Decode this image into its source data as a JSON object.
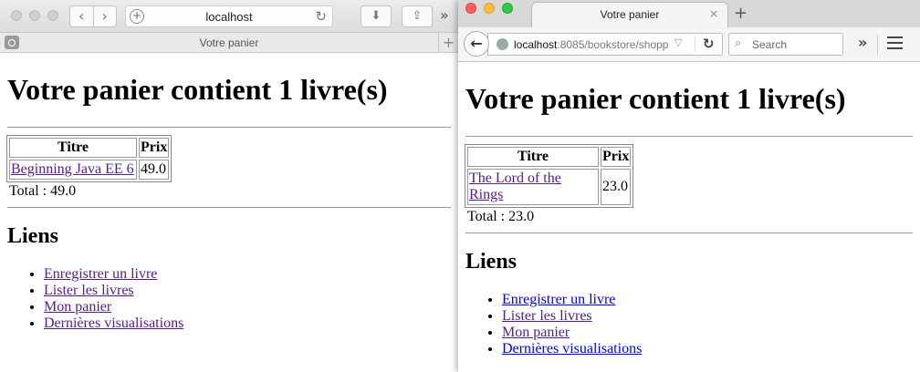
{
  "left": {
    "address": "localhost",
    "tab_title": "Votre panier",
    "page": {
      "heading": "Votre panier contient 1 livre(s)",
      "table": {
        "headers": [
          "Titre",
          "Prix"
        ],
        "rows": [
          {
            "title": "Beginning Java EE 6",
            "price": "49.0"
          }
        ]
      },
      "total": "Total : 49.0",
      "links_heading": "Liens",
      "links": [
        "Enregistrer un livre",
        "Lister les livres",
        "Mon panier",
        "Dernières visualisations"
      ]
    }
  },
  "right": {
    "tab_title": "Votre panier",
    "url_host": "localhost",
    "url_rest": ":8085/bookstore/shopp",
    "search_placeholder": "Search",
    "page": {
      "heading": "Votre panier contient 1 livre(s)",
      "table": {
        "headers": [
          "Titre",
          "Prix"
        ],
        "rows": [
          {
            "title": "The Lord of the Rings",
            "price": "23.0"
          }
        ]
      },
      "total": "Total : 23.0",
      "links_heading": "Liens",
      "links": [
        "Enregistrer un livre",
        "Lister les livres",
        "Mon panier",
        "Dernières visualisations"
      ]
    }
  },
  "icons": {
    "back": "←",
    "forward": "→",
    "reload": "↻",
    "download": "⬇",
    "share": "⇪",
    "overflow": "»",
    "close": "×",
    "new_tab": "+",
    "search": "⌕",
    "dropdown": "▽",
    "nav_back": "‹",
    "nav_forward": "›"
  }
}
